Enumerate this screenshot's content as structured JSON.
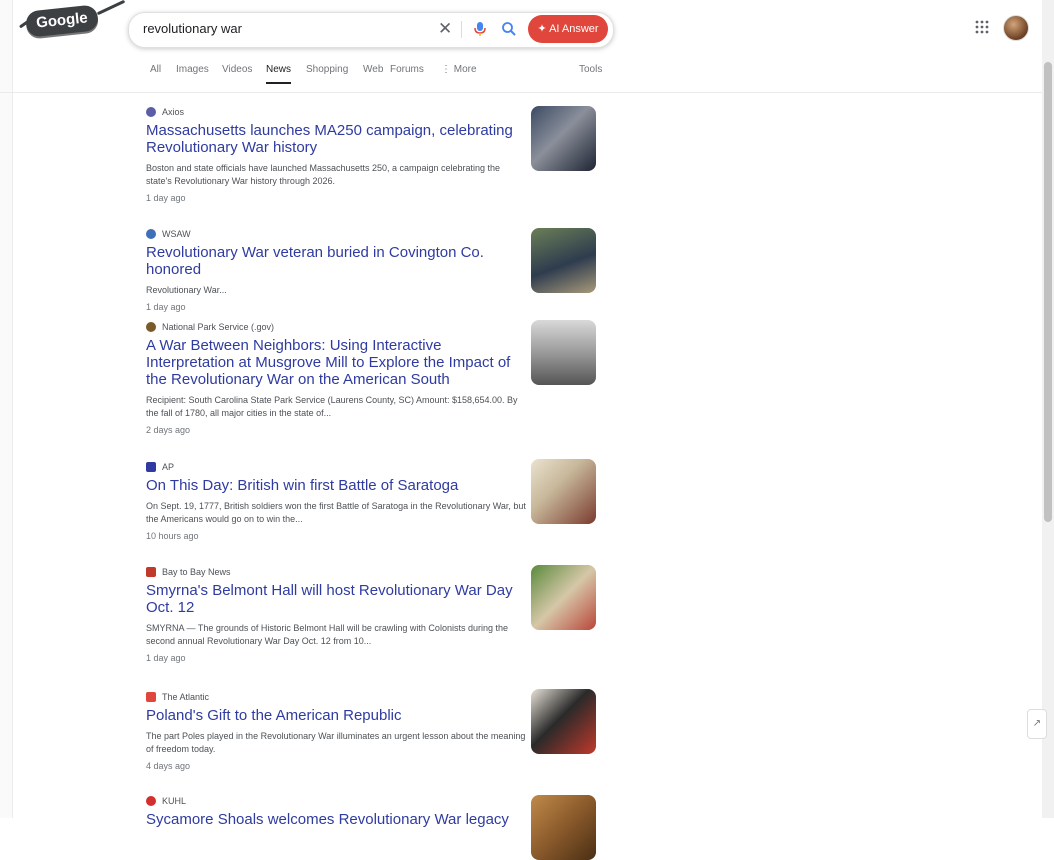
{
  "header": {
    "logo_text": "Google",
    "search_query": "revolutionary war",
    "ai_button_label": "AI Answer"
  },
  "tabs": [
    {
      "label": "All"
    },
    {
      "label": "Images"
    },
    {
      "label": "Videos"
    },
    {
      "label": "News",
      "active": true
    },
    {
      "label": "Shopping"
    },
    {
      "label": "Web"
    },
    {
      "label": "Forums"
    },
    {
      "label": "⋮ More"
    },
    {
      "label": "Tools"
    }
  ],
  "results": [
    {
      "source": "Axios",
      "title": "Massachusetts launches MA250 campaign, celebrating Revolutionary War history",
      "snippet": "Boston and state officials have launched Massachusetts 250, a campaign celebrating the state's Revolutionary War history through 2026.",
      "time": "1 day ago",
      "favicon_color": "#5b5ea6",
      "thumb_colors": [
        "#3b4a63",
        "#8a8f9a",
        "#1e2433"
      ]
    },
    {
      "source": "WSAW",
      "title": "Revolutionary War veteran buried in Covington Co. honored",
      "snippet": "Revolutionary War...",
      "time": "1 day ago",
      "favicon_color": "#3f6fb5",
      "thumb_colors": [
        "#6b7f57",
        "#2e3c4e",
        "#a89a7a"
      ]
    },
    {
      "source": "National Park Service (.gov)",
      "title": "A War Between Neighbors: Using Interactive Interpretation at Musgrove Mill to Explore the Impact of the Revolutionary War on the American South",
      "snippet": "Recipient: South Carolina State Park Service (Laurens County, SC) Amount: $158,654.00. By the fall of 1780, all major cities in the state of...",
      "time": "2 days ago",
      "favicon_color": "#7b5a2a",
      "thumb_colors": [
        "#d9d9d9",
        "#555555",
        "#9a9a9a"
      ]
    },
    {
      "source": "AP",
      "title": "On This Day: British win first Battle of Saratoga",
      "snippet": "On Sept. 19, 1777, British soldiers won the first Battle of Saratoga in the Revolutionary War, but the Americans would go on to win the...",
      "time": "10 hours ago",
      "favicon_color": "#2f3ba0",
      "thumb_colors": [
        "#c8b89a",
        "#7a3b2e",
        "#eae2d0"
      ]
    },
    {
      "source": "Bay to Bay News",
      "title": "Smyrna's Belmont Hall will host Revolutionary War Day Oct. 12",
      "snippet": "SMYRNA — The grounds of Historic Belmont Hall will be crawling with Colonists during the second annual Revolutionary War Day Oct. 12 from 10...",
      "time": "1 day ago",
      "favicon_color": "#c0392b",
      "thumb_colors": [
        "#5a8a3c",
        "#d6c7a8",
        "#b8463a"
      ]
    },
    {
      "source": "The Atlantic",
      "title": "Poland's Gift to the American Republic",
      "snippet": "The part Poles played in the Revolutionary War illuminates an urgent lesson about the meaning of freedom today.",
      "time": "4 days ago",
      "favicon_color": "#e0463b",
      "thumb_colors": [
        "#2a2a2a",
        "#c0392b",
        "#e8e2d8"
      ]
    },
    {
      "source": "KUHL",
      "title": "Sycamore Shoals welcomes Revolutionary War legacy",
      "snippet": "",
      "time": "",
      "favicon_color": "#d32f2f",
      "thumb_colors": [
        "#8a5a2b",
        "#c08a4a",
        "#4a2e14"
      ]
    }
  ]
}
